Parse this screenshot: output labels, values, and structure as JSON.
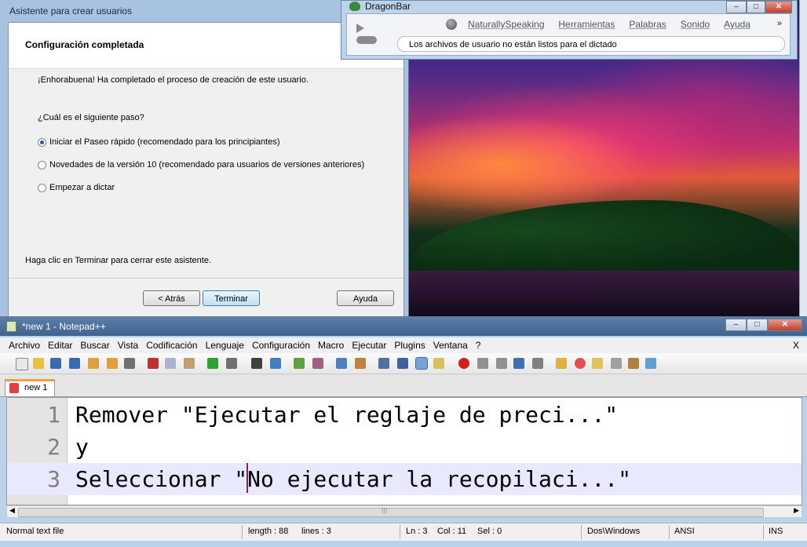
{
  "wizard": {
    "title": "Asistente para crear usuarios",
    "header": "Configuración completada",
    "congrats": "¡Enhorabuena! Ha completado el proceso de creación de este usuario.",
    "question": "¿Cuál es el siguiente paso?",
    "options": [
      {
        "label": "Iniciar el Paseo rápido (recomendado para los principiantes)",
        "selected": true
      },
      {
        "label": "Novedades de la versión 10 (recomendado para usuarios de versiones anteriores)",
        "selected": false
      },
      {
        "label": "Empezar a dictar",
        "selected": false
      }
    ],
    "footer_hint": "Haga clic en Terminar para cerrar este asistente.",
    "buttons": {
      "back": "< Atrás",
      "finish": "Terminar",
      "help": "Ayuda"
    }
  },
  "dragonbar": {
    "title": "DragonBar",
    "menu": [
      "NaturallySpeaking",
      "Herramientas",
      "Palabras",
      "Sonido",
      "Ayuda"
    ],
    "more": "»",
    "status": "Los archivos de usuario no están listos para el dictado"
  },
  "notepad": {
    "title": "*new 1 - Notepad++",
    "close_x": "X",
    "menu": [
      "Archivo",
      "Editar",
      "Buscar",
      "Vista",
      "Codificación",
      "Lenguaje",
      "Configuración",
      "Macro",
      "Ejecutar",
      "Plugins",
      "Ventana",
      "?"
    ],
    "tab": "new 1",
    "lines": [
      {
        "num": "1",
        "text": "Remover \"Ejecutar el reglaje de preci...\""
      },
      {
        "num": "2",
        "text": "y"
      },
      {
        "num": "3",
        "text": "Seleccionar \"No ejecutar la recopilaci...\""
      }
    ],
    "scroll_grip": "⁞⁞⁞",
    "status": {
      "filetype": "Normal text file",
      "length": "length : 88",
      "lines": "lines : 3",
      "ln": "Ln : 3",
      "col": "Col : 11",
      "sel": "Sel : 0",
      "eol": "Dos\\Windows",
      "encoding": "ANSI",
      "mode": "INS"
    }
  },
  "window_controls": {
    "minimize": "–",
    "maximize": "□",
    "close": "✕"
  }
}
